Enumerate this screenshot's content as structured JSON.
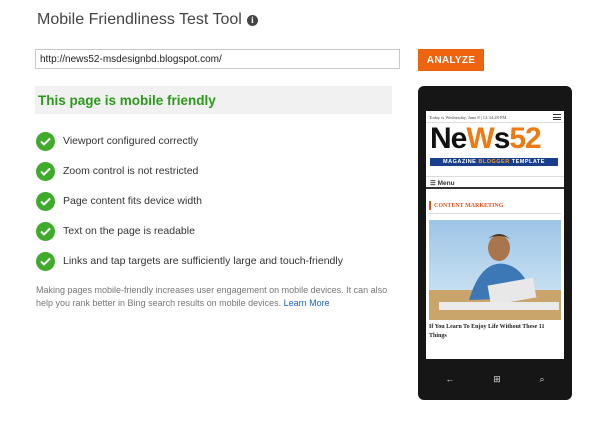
{
  "header": {
    "title": "Mobile Friendliness Test Tool",
    "info_icon": "info-icon"
  },
  "form": {
    "url_value": "http://news52-msdesignbd.blogspot.com/",
    "analyze_label": "ANALYZE"
  },
  "result": {
    "verdict": "This page is mobile friendly",
    "checks": [
      {
        "label": "Viewport configured correctly",
        "icon": "check-circle-icon"
      },
      {
        "label": "Zoom control is not restricted",
        "icon": "check-circle-icon"
      },
      {
        "label": "Page content fits device width",
        "icon": "check-circle-icon"
      },
      {
        "label": "Text on the page is readable",
        "icon": "check-circle-icon"
      },
      {
        "label": "Links and tap targets are sufficiently large and touch-friendly",
        "icon": "check-circle-icon"
      }
    ],
    "note": "Making pages mobile-friendly increases user engagement on mobile devices. It can also help you rank better in Bing search results on mobile devices.",
    "learn_more": "Learn More"
  },
  "preview": {
    "date_line": "Today is Wednesday, June 8 | 12:34:28 PM",
    "logo_pre": "Ne",
    "logo_w": "W",
    "logo_s": "s",
    "logo_num": "52",
    "tagline_pre": "MAGAZINE",
    "tagline_mid": "BLOGGER",
    "tagline_post": "TEMPLATE",
    "menu_label": "Menu",
    "category": "CONTENT MARKETING",
    "headline": "If You Learn To Enjoy Life Without These 11 Things"
  },
  "colors": {
    "accent": "#ee6411",
    "success": "#3fab2a",
    "verdict_text": "#2a9a1a",
    "link": "#1a63c9"
  }
}
